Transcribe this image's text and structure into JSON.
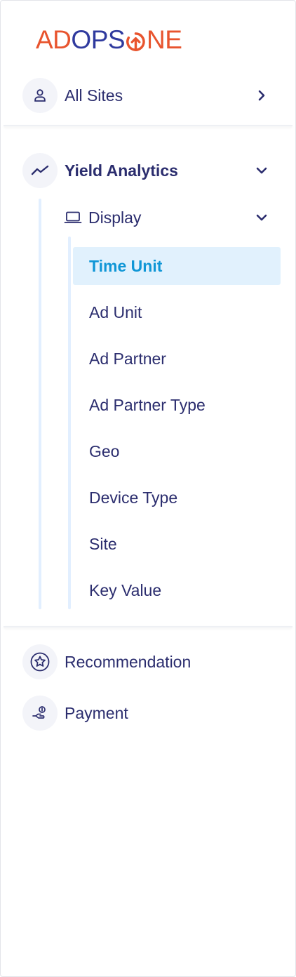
{
  "brand": {
    "logo_text_left": "AD",
    "logo_text_o": "O",
    "logo_text_ps": "PS",
    "logo_text_ne": "NE",
    "colors": {
      "orange": "#e8542e",
      "navy": "#2f3a9e"
    }
  },
  "nav": {
    "all_sites": {
      "label": "All Sites",
      "icon": "user-icon",
      "chevron": "chevron-right-icon"
    },
    "yield_analytics": {
      "label": "Yield Analytics",
      "icon": "trend-line-icon",
      "chevron": "chevron-down-icon",
      "expanded": true
    },
    "display": {
      "label": "Display",
      "icon": "laptop-icon",
      "chevron": "chevron-down-icon",
      "expanded": true
    },
    "display_items": [
      {
        "label": "Time Unit",
        "active": true
      },
      {
        "label": "Ad Unit",
        "active": false
      },
      {
        "label": "Ad Partner",
        "active": false
      },
      {
        "label": "Ad Partner Type",
        "active": false
      },
      {
        "label": "Geo",
        "active": false
      },
      {
        "label": "Device Type",
        "active": false
      },
      {
        "label": "Site",
        "active": false
      },
      {
        "label": "Key Value",
        "active": false
      }
    ],
    "recommendation": {
      "label": "Recommendation",
      "icon": "star-badge-icon"
    },
    "payment": {
      "label": "Payment",
      "icon": "payment-hand-icon"
    }
  },
  "theme": {
    "text": "#2b2d6e",
    "active_text": "#0f96d6",
    "active_bg": "#e1f1fd",
    "tree_line": "#e2efff"
  }
}
